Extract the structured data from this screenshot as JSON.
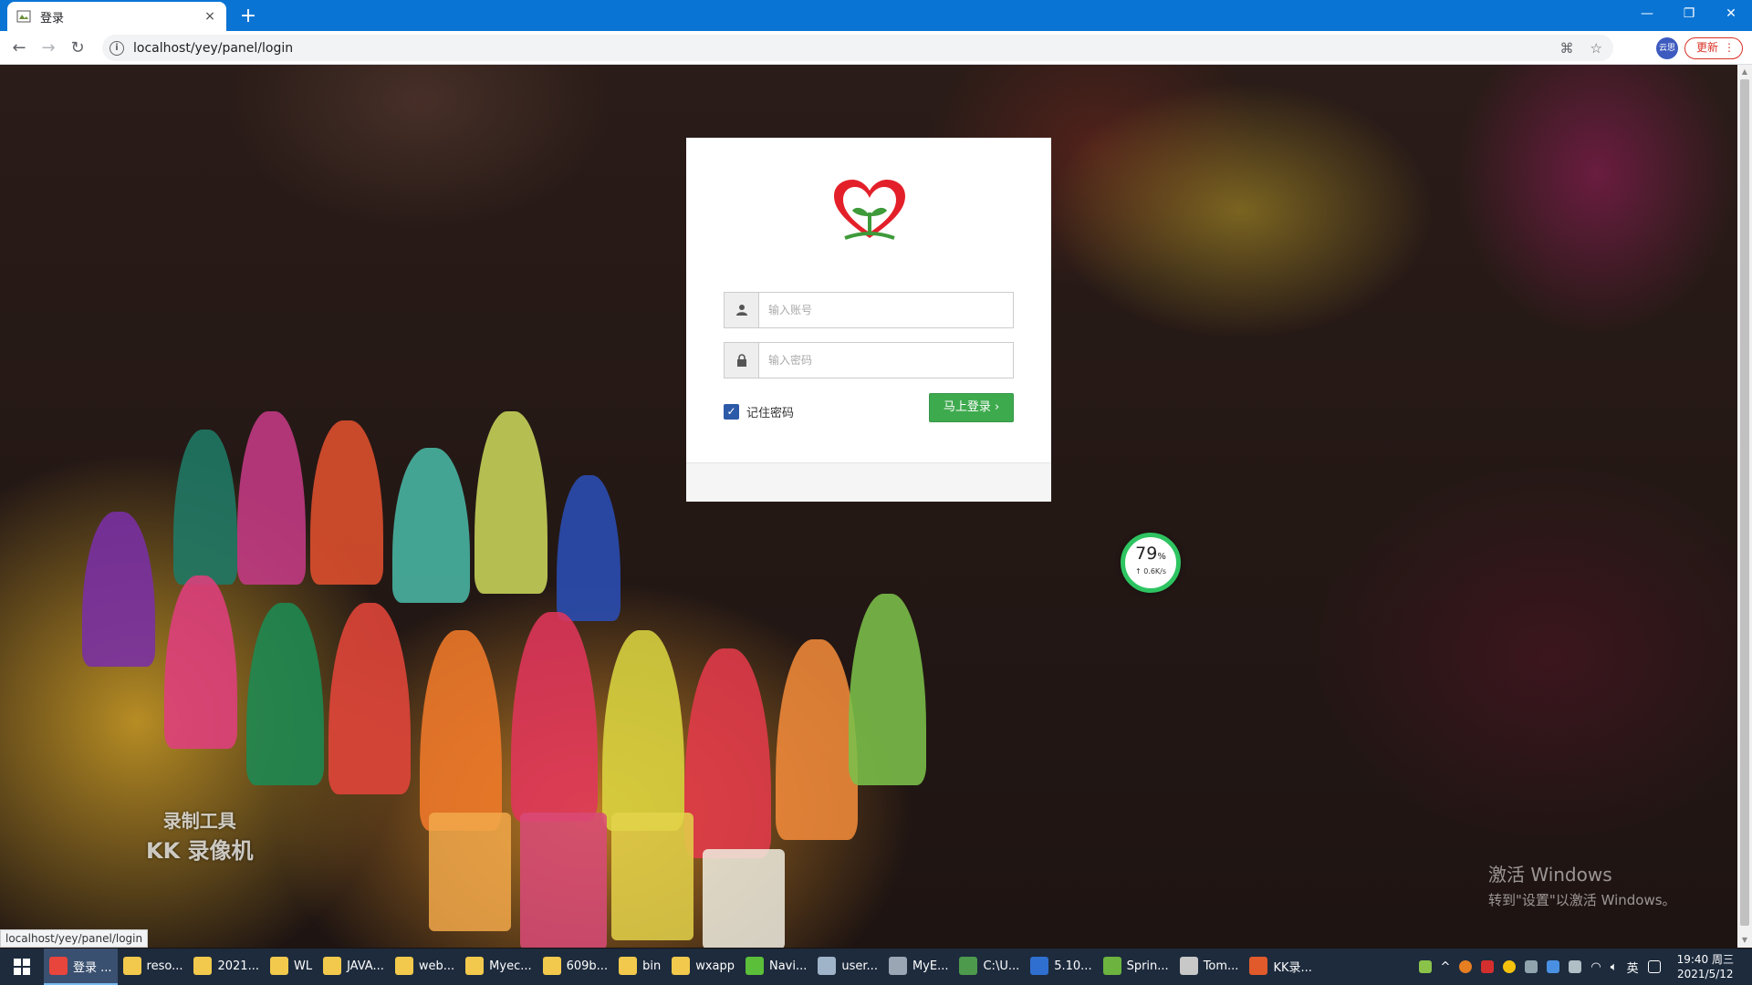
{
  "browser": {
    "tab_title": "登录",
    "tab_close": "×",
    "new_tab": "+",
    "url": "localhost/yey/panel/login",
    "update_label": "更新",
    "profile_label": "云思",
    "win_min": "—",
    "win_max": "❐",
    "win_close": "✕"
  },
  "login": {
    "username_placeholder": "输入账号",
    "password_placeholder": "输入密码",
    "remember_label": "记住密码",
    "remember_checked": true,
    "login_button": "马上登录 ›"
  },
  "speed_widget": {
    "percent": "79",
    "percent_unit": "%",
    "rate": "↑ 0.6K/s"
  },
  "watermark": {
    "line1": "录制工具",
    "line2": "KK 录像机"
  },
  "activation": {
    "title": "激活 Windows",
    "subtitle": "转到\"设置\"以激活 Windows。"
  },
  "status_url": "localhost/yey/panel/login",
  "taskbar": {
    "items": [
      {
        "label": "登录 ...",
        "color": "#e8453c"
      },
      {
        "label": "reso...",
        "color": "#f2c94c"
      },
      {
        "label": "2021...",
        "color": "#f2c94c"
      },
      {
        "label": "WL",
        "color": "#f2c94c"
      },
      {
        "label": "JAVA...",
        "color": "#f2c94c"
      },
      {
        "label": "web...",
        "color": "#f2c94c"
      },
      {
        "label": "Myec...",
        "color": "#f2c94c"
      },
      {
        "label": "609b...",
        "color": "#f2c94c"
      },
      {
        "label": "bin",
        "color": "#f2c94c"
      },
      {
        "label": "wxapp",
        "color": "#f2c94c"
      },
      {
        "label": "Navi...",
        "color": "#5bbf3a"
      },
      {
        "label": "user...",
        "color": "#9fb4c8"
      },
      {
        "label": "MyE...",
        "color": "#9aa6b4"
      },
      {
        "label": "C:\\U...",
        "color": "#4d9a4d"
      },
      {
        "label": "5.10...",
        "color": "#2f6fd0"
      },
      {
        "label": "Sprin...",
        "color": "#6db33f"
      },
      {
        "label": "Tom...",
        "color": "#c8c8c8"
      },
      {
        "label": "KK录...",
        "color": "#e05a2b"
      }
    ],
    "tray_ime": "英",
    "clock_time": "19:40 周三",
    "clock_date": "2021/5/12"
  }
}
